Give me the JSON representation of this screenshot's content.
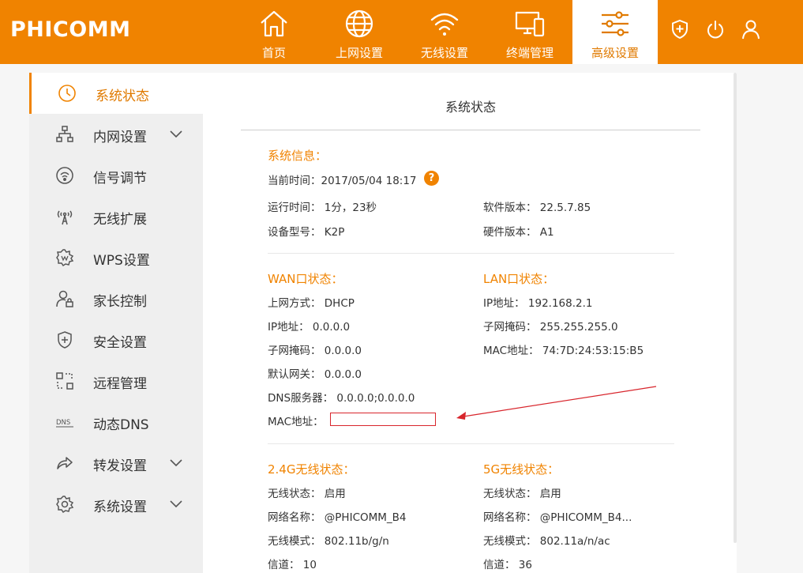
{
  "brand": {
    "logo": "PHICOMM",
    "accent": "#f08300"
  },
  "nav": {
    "items": [
      {
        "label": "首页",
        "icon": "home-icon"
      },
      {
        "label": "上网设置",
        "icon": "globe-icon"
      },
      {
        "label": "无线设置",
        "icon": "wifi-icon"
      },
      {
        "label": "终端管理",
        "icon": "devices-icon"
      },
      {
        "label": "高级设置",
        "icon": "sliders-icon"
      }
    ],
    "active": "高级设置",
    "right_icons": [
      "shield-plus-icon",
      "power-icon",
      "user-icon"
    ]
  },
  "sidebar": {
    "items": [
      {
        "label": "系统状态",
        "icon": "clock-icon"
      },
      {
        "label": "内网设置",
        "icon": "network-icon",
        "expandable": true
      },
      {
        "label": "信号调节",
        "icon": "signal-icon"
      },
      {
        "label": "无线扩展",
        "icon": "wireless-extend-icon"
      },
      {
        "label": "WPS设置",
        "icon": "wps-gear-icon"
      },
      {
        "label": "家长控制",
        "icon": "parental-lock-icon"
      },
      {
        "label": "安全设置",
        "icon": "shield-icon"
      },
      {
        "label": "远程管理",
        "icon": "remote-icon"
      },
      {
        "label": "动态DNS",
        "icon": "dns-icon"
      },
      {
        "label": "转发设置",
        "icon": "forward-icon",
        "expandable": true
      },
      {
        "label": "系统设置",
        "icon": "gear-icon",
        "expandable": true
      }
    ],
    "active": "系统状态"
  },
  "main": {
    "title": "系统状态",
    "system": {
      "heading": "系统信息：",
      "current_time": "当前时间：2017/05/04 18:17",
      "uptime": "运行时间： 1分，23秒",
      "model": "设备型号： K2P",
      "software": "软件版本： 22.5.7.85",
      "hardware": "硬件版本： A1"
    },
    "wan": {
      "heading": "WAN口状态：",
      "mode": "上网方式： DHCP",
      "ip": "IP地址： 0.0.0.0",
      "mask": "子网掩码： 0.0.0.0",
      "gateway": "默认网关： 0.0.0.0",
      "dns": "DNS服务器： 0.0.0.0;0.0.0.0",
      "mac_label": "MAC地址："
    },
    "lan": {
      "heading": "LAN口状态：",
      "ip": "IP地址： 192.168.2.1",
      "mask": "子网掩码： 255.255.255.0",
      "mac": "MAC地址： 74:7D:24:53:15:B5"
    },
    "wifi24": {
      "heading": "2.4G无线状态：",
      "status": "无线状态： 启用",
      "ssid": "网络名称： @PHICOMM_B4",
      "mode": "无线模式： 802.11b/g/n",
      "channel": "信道： 10"
    },
    "wifi5": {
      "heading": "5G无线状态：",
      "status": "无线状态： 启用",
      "ssid": "网络名称： @PHICOMM_B4...",
      "mode": "无线模式： 802.11a/n/ac",
      "channel": "信道： 36"
    },
    "help_glyph": "?"
  }
}
